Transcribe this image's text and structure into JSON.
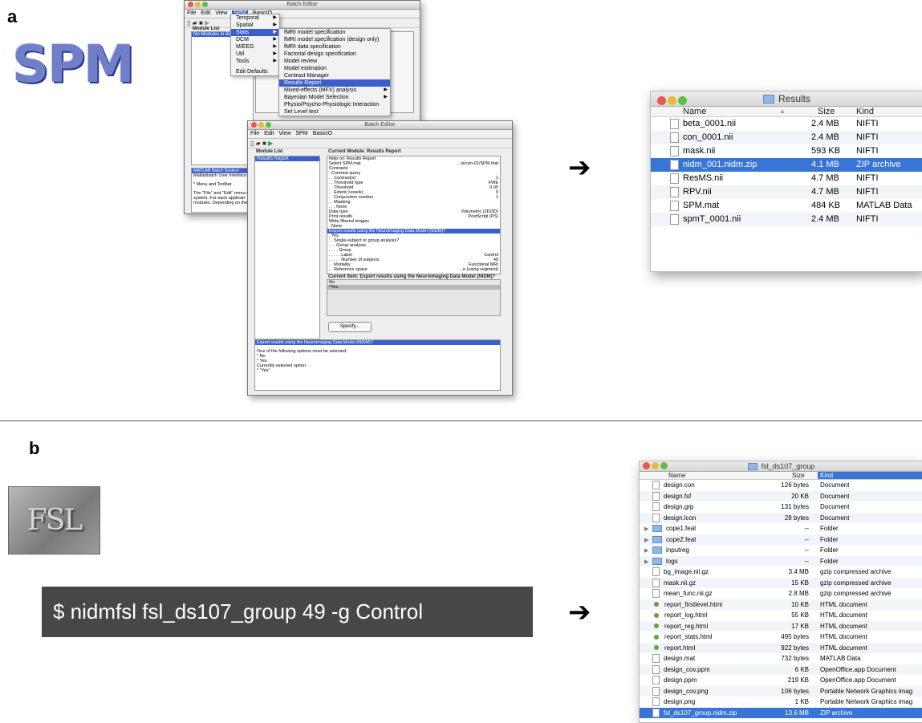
{
  "panel_a": {
    "letter": "a",
    "spm_logo": "SPM",
    "back_window": {
      "title": "Batch Editor",
      "menus": [
        "File",
        "Edit",
        "View",
        "SPM",
        "BasicIO"
      ],
      "module_list_label": "Module List",
      "module_list_item": "No Modules in Batch",
      "spm_menu": [
        {
          "label": "Temporal",
          "submenu": true
        },
        {
          "label": "Spatial",
          "submenu": true
        },
        {
          "label": "Stats",
          "submenu": true
        },
        {
          "label": "DCM",
          "submenu": true
        },
        {
          "label": "M/EEG",
          "submenu": true
        },
        {
          "label": "Util",
          "submenu": true
        },
        {
          "label": "Tools",
          "submenu": true
        },
        {
          "label": "Edit Defaults",
          "submenu": false
        }
      ],
      "stats_menu": [
        {
          "label": "fMRI model specification",
          "submenu": false
        },
        {
          "label": "fMRI model specification (design only)",
          "submenu": false
        },
        {
          "label": "fMRI data specification",
          "submenu": false
        },
        {
          "label": "Factorial design specification",
          "submenu": false
        },
        {
          "label": "Model review",
          "submenu": false
        },
        {
          "label": "Model estimation",
          "submenu": false
        },
        {
          "label": "Contrast Manager",
          "submenu": false
        },
        {
          "label": "Results Report",
          "submenu": false,
          "selected": true
        },
        {
          "label": "Mixed-effects (MFX) analysis",
          "submenu": true
        },
        {
          "label": "Bayesian Model Selection",
          "submenu": true
        },
        {
          "label": "Physio/Psycho-Physiologic Interaction",
          "submenu": false
        },
        {
          "label": "Set Level test",
          "submenu": false
        }
      ],
      "help_lines": [
        "MATLAB Batch System",
        "Matlabbatch User Interface",
        "",
        "* Menu and Toolbar",
        "",
        "The \"File\" and \"Edit\" menu o",
        "system. For each applicati",
        "modules. Depending on the"
      ]
    },
    "front_window": {
      "title": "Batch Editor",
      "menus": [
        "File",
        "Edit",
        "View",
        "SPM",
        "BasicIO"
      ],
      "module_list_label": "Module List",
      "module_list_item": "Results Report",
      "current_module_label": "Current Module: Results Report",
      "entries": [
        {
          "k": "Help on: Results Report",
          "v": ""
        },
        {
          "k": "Select SPM.mat",
          "v": "...is/con-01/SPM.mat"
        },
        {
          "k": "Contrasts",
          "v": ""
        },
        {
          "k": ". Contrast query",
          "v": ""
        },
        {
          "k": ". . Contrast(s)",
          "v": "1"
        },
        {
          "k": ". . Threshold type",
          "v": "FWE"
        },
        {
          "k": ". . Threshold",
          "v": "0.05"
        },
        {
          "k": ". . Extent (voxels)",
          "v": "0"
        },
        {
          "k": ". . Conjunction number",
          "v": "1"
        },
        {
          "k": ". . Masking",
          "v": ""
        },
        {
          "k": ". . . None",
          "v": ""
        },
        {
          "k": "Data type",
          "v": "Volumetric (2D/3D)"
        },
        {
          "k": "Print results",
          "v": "PostScript (PS)"
        },
        {
          "k": "Write filtered images",
          "v": ""
        },
        {
          "k": ". None",
          "v": ""
        },
        {
          "k": "Export results using the Neuroimaging Data Model (NIDM)?",
          "v": "",
          "hl": true
        },
        {
          "k": ". Yes",
          "v": ""
        },
        {
          "k": ". . Single-subject or group analysis?",
          "v": ""
        },
        {
          "k": ". . . Group analysis",
          "v": ""
        },
        {
          "k": ". . . . Group",
          "v": ""
        },
        {
          "k": ". . . . . Label",
          "v": "Control"
        },
        {
          "k": ". . . . . Number of subjects",
          "v": "49"
        },
        {
          "k": ". . Modality",
          "v": "Functional MRI"
        },
        {
          "k": ". . Reference space",
          "v": "...e (using segment)"
        }
      ],
      "current_item_label": "Current Item: Export results using the Neuroimaging Data Model (NIDM)?",
      "item_options": [
        "No",
        "*Yes"
      ],
      "specify_button": "Specify...",
      "help_title": "Export results using the Neuroimaging Data Model (NIDM)?",
      "help_lines": [
        "",
        "One of the following options must be selected:",
        "* No",
        "* Yes",
        "Currently selected option:",
        "* \"Yes\""
      ]
    },
    "finder": {
      "title": "Results",
      "columns": {
        "name": "Name",
        "size": "Size",
        "kind": "Kind"
      },
      "rows": [
        {
          "name": "beta_0001.nii",
          "size": "2.4 MB",
          "kind": "NIFTI"
        },
        {
          "name": "con_0001.nii",
          "size": "2.4 MB",
          "kind": "NIFTI"
        },
        {
          "name": "mask.nii",
          "size": "593 KB",
          "kind": "NIFTI"
        },
        {
          "name": "nidm_001.nidm.zip",
          "size": "4.1 MB",
          "kind": "ZIP archive",
          "selected": true
        },
        {
          "name": "ResMS.nii",
          "size": "4.7 MB",
          "kind": "NIFTI"
        },
        {
          "name": "RPV.nii",
          "size": "4.7 MB",
          "kind": "NIFTI"
        },
        {
          "name": "SPM.mat",
          "size": "484 KB",
          "kind": "MATLAB Data"
        },
        {
          "name": "spmT_0001.nii",
          "size": "2.4 MB",
          "kind": "NIFTI"
        }
      ]
    }
  },
  "panel_b": {
    "letter": "b",
    "fsl_logo": "FSL",
    "command": "$ nidmfsl fsl_ds107_group 49 -g Control",
    "finder": {
      "title": "fsl_ds107_group",
      "columns": {
        "name": "Name",
        "size": "Size",
        "kind": "Kind"
      },
      "rows": [
        {
          "name": "design.con",
          "size": "126 bytes",
          "kind": "Document",
          "type": "file"
        },
        {
          "name": "design.fsf",
          "size": "20 KB",
          "kind": "Document",
          "type": "file"
        },
        {
          "name": "design.grp",
          "size": "131 bytes",
          "kind": "Document",
          "type": "file"
        },
        {
          "name": "design.lcon",
          "size": "28 bytes",
          "kind": "Document",
          "type": "file"
        },
        {
          "name": "cope1.feat",
          "size": "--",
          "kind": "Folder",
          "type": "folder"
        },
        {
          "name": "cope2.feat",
          "size": "--",
          "kind": "Folder",
          "type": "folder"
        },
        {
          "name": "inputreg",
          "size": "--",
          "kind": "Folder",
          "type": "folder"
        },
        {
          "name": "logs",
          "size": "--",
          "kind": "Folder",
          "type": "folder"
        },
        {
          "name": "bg_image.nii.gz",
          "size": "3.4 MB",
          "kind": "gzip compressed archive",
          "type": "file"
        },
        {
          "name": "mask.nii.gz",
          "size": "15 KB",
          "kind": "gzip compressed archive",
          "type": "file"
        },
        {
          "name": "mean_func.nii.gz",
          "size": "2.8 MB",
          "kind": "gzip compressed archive",
          "type": "file"
        },
        {
          "name": "report_firstlevel.html",
          "size": "10 KB",
          "kind": "HTML document",
          "type": "html"
        },
        {
          "name": "report_log.html",
          "size": "55 KB",
          "kind": "HTML document",
          "type": "html"
        },
        {
          "name": "report_reg.html",
          "size": "17 KB",
          "kind": "HTML document",
          "type": "html"
        },
        {
          "name": "report_stats.html",
          "size": "495 bytes",
          "kind": "HTML document",
          "type": "html"
        },
        {
          "name": "report.html",
          "size": "922 bytes",
          "kind": "HTML document",
          "type": "html"
        },
        {
          "name": "design.mat",
          "size": "732 bytes",
          "kind": "MATLAB Data",
          "type": "file"
        },
        {
          "name": "design_cov.ppm",
          "size": "6 KB",
          "kind": "OpenOffice.app Document",
          "type": "file"
        },
        {
          "name": "design.ppm",
          "size": "219 KB",
          "kind": "OpenOffice.app Document",
          "type": "file"
        },
        {
          "name": "design_cov.png",
          "size": "106 bytes",
          "kind": "Portable Network Graphics imag",
          "type": "file"
        },
        {
          "name": "design.png",
          "size": "1 KB",
          "kind": "Portable Network Graphics imag",
          "type": "file"
        },
        {
          "name": "fsl_ds107_group.nidm.zip",
          "size": "13.6 MB",
          "kind": "ZIP archive",
          "type": "file",
          "selected": true
        }
      ]
    }
  },
  "colors": {
    "selection": "#3875d7",
    "matlab_highlight": "#3a5fcd",
    "command_bg": "#474747"
  }
}
